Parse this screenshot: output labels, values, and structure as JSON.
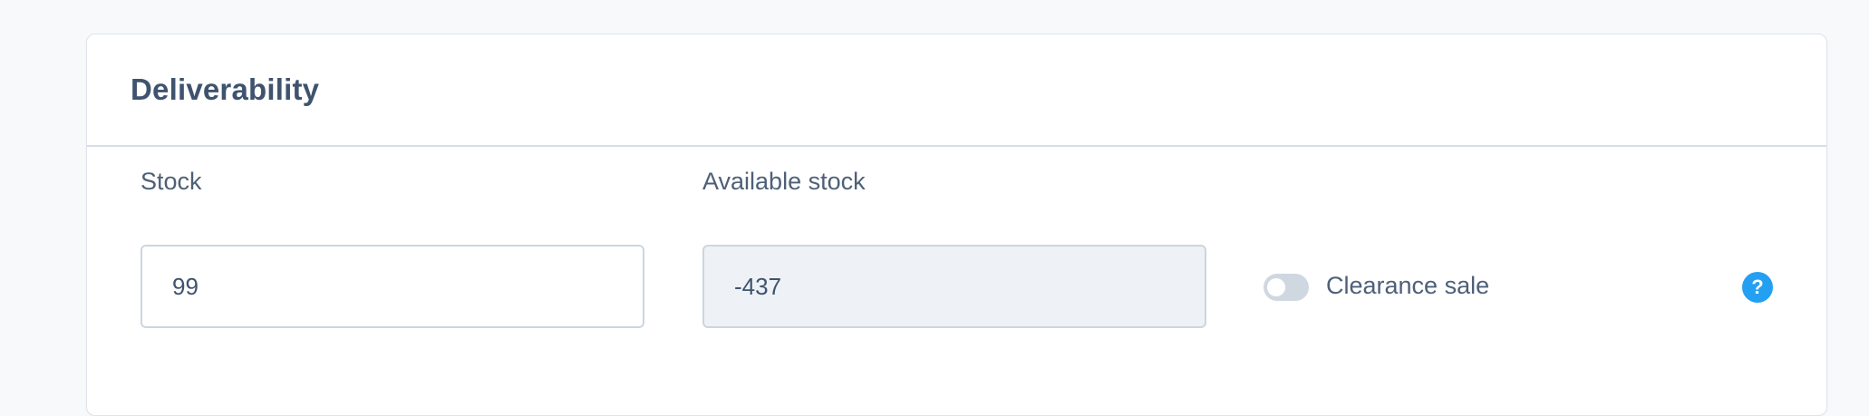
{
  "card": {
    "title": "Deliverability"
  },
  "fields": {
    "stock": {
      "label": "Stock",
      "value": "99"
    },
    "available_stock": {
      "label": "Available stock",
      "value": "-437"
    }
  },
  "clearance": {
    "label": "Clearance sale",
    "enabled": false
  },
  "help": {
    "glyph": "?",
    "icon": "question-circle-icon"
  }
}
